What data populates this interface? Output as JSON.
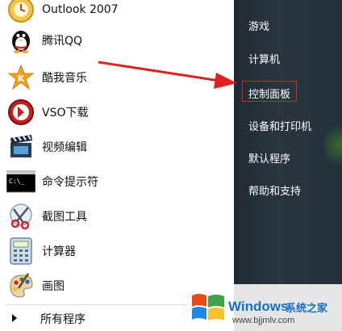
{
  "left_menu": {
    "items": [
      {
        "label": "Outlook 2007",
        "icon": "outlook-icon"
      },
      {
        "label": "腾讯QQ",
        "icon": "qq-penguin-icon"
      },
      {
        "label": "酷我音乐",
        "icon": "kuwo-music-icon"
      },
      {
        "label": "VSO下载",
        "icon": "vso-download-icon"
      },
      {
        "label": "视频编辑",
        "icon": "clapperboard-icon"
      },
      {
        "label": "命令提示符",
        "icon": "command-prompt-icon"
      },
      {
        "label": "截图工具",
        "icon": "scissors-icon"
      },
      {
        "label": "计算器",
        "icon": "calculator-icon"
      },
      {
        "label": "画图",
        "icon": "paint-palette-icon"
      }
    ],
    "all_programs_label": "所有程序"
  },
  "right_menu": {
    "items": [
      {
        "label": "游戏"
      },
      {
        "label": "计算机"
      },
      {
        "label": "控制面板"
      },
      {
        "label": "设备和打印机"
      },
      {
        "label": "默认程序"
      },
      {
        "label": "帮助和支持"
      }
    ],
    "highlighted_item": "控制面板"
  },
  "annotation": {
    "arrow_color": "#e02020",
    "box_color": "#dd2222"
  },
  "watermark": {
    "brand": "Windows",
    "sub": "系统之家",
    "url": "www.bjjmlv.com"
  },
  "colors": {
    "right_panel_bg": "#26313b",
    "watermark_blue": "#1a6fc4"
  }
}
